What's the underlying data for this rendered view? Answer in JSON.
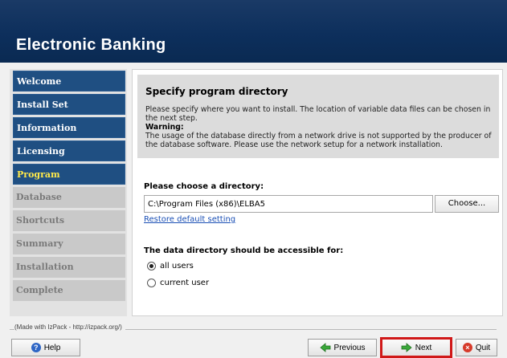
{
  "app": {
    "title": "Electronic Banking"
  },
  "sidebar": {
    "items": [
      {
        "label": "Welcome",
        "state": "done"
      },
      {
        "label": "Install Set",
        "state": "done"
      },
      {
        "label": "Information",
        "state": "done"
      },
      {
        "label": "Licensing",
        "state": "done"
      },
      {
        "label": "Program",
        "state": "current"
      },
      {
        "label": "Database",
        "state": "pending"
      },
      {
        "label": "Shortcuts",
        "state": "pending"
      },
      {
        "label": "Summary",
        "state": "pending"
      },
      {
        "label": "Installation",
        "state": "pending"
      },
      {
        "label": "Complete",
        "state": "pending"
      }
    ]
  },
  "main": {
    "heading": "Specify program directory",
    "description": "Please specify where you want to install. The location of variable data files can be chosen in the next step.",
    "warning_title": "Warning:",
    "warning_text": "The usage of the database directly from a network drive is not supported by the producer of the database software. Please use the network setup for a network installation.",
    "dir_label": "Please choose a directory:",
    "dir_value": "C:\\Program Files (x86)\\ELBA5",
    "choose_label": "Choose...",
    "restore_label": "Restore default setting",
    "access_label": "The data directory should be accessible for:",
    "options": [
      {
        "label": "all users",
        "selected": true
      },
      {
        "label": "current user",
        "selected": false
      }
    ]
  },
  "footer": {
    "credit": "(Made with IzPack - http://izpack.org/)",
    "help_label": "Help",
    "previous_label": "Previous",
    "next_label": "Next",
    "quit_label": "Quit"
  },
  "colors": {
    "banner": "#0d2f5c",
    "nav_done": "#1f4f82",
    "nav_current_text": "#ffe94a",
    "highlight": "#d01818"
  }
}
